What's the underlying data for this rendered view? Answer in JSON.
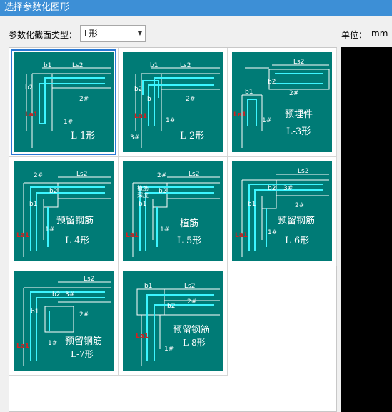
{
  "window": {
    "title": "选择参数化图形"
  },
  "toolbar": {
    "type_label": "参数化截面类型：",
    "type_value": "L形",
    "unit_label": "单位：",
    "unit_value": "mm"
  },
  "shapes": [
    {
      "caption": "L-1形",
      "extra": "",
      "labels": [
        "b1",
        "Ls2",
        "b2",
        "2#",
        "La1",
        "1#"
      ]
    },
    {
      "caption": "L-2形",
      "extra": "",
      "labels": [
        "b1",
        "Ls2",
        "b2",
        "2#",
        "b",
        "La1",
        "1#",
        "3#"
      ]
    },
    {
      "caption": "L-3形",
      "extra": "预埋件",
      "labels": [
        "b2",
        "Ls2",
        "b1",
        "2#",
        "La1",
        "1#"
      ]
    },
    {
      "caption": "L-4形",
      "extra": "预留钢筋",
      "labels": [
        "2#",
        "Ls2",
        "b2",
        "b1",
        "La1",
        "1#"
      ]
    },
    {
      "caption": "L-5形",
      "extra": "植筋",
      "labels": [
        "2#",
        "Ls2",
        "植筋",
        "深度",
        "b2",
        "b1",
        "La1",
        "1#"
      ]
    },
    {
      "caption": "L-6形",
      "extra": "预留钢筋",
      "labels": [
        "Ls2",
        "b2",
        "3#",
        "b1",
        "2#",
        "La1",
        "1#"
      ]
    },
    {
      "caption": "L-7形",
      "extra": "预留钢筋",
      "labels": [
        "Ls2",
        "b2",
        "3#",
        "b1",
        "2#",
        "La1",
        "1#"
      ]
    },
    {
      "caption": "L-8形",
      "extra": "预留钢筋",
      "labels": [
        "b1",
        "Ls2",
        "b2",
        "2#",
        "La1",
        "1#"
      ]
    }
  ],
  "colors": {
    "tile_bg": "#007b76",
    "rebar": "#3cf5ff",
    "label_red": "#d81e1e",
    "select_border": "#2a78d4"
  }
}
